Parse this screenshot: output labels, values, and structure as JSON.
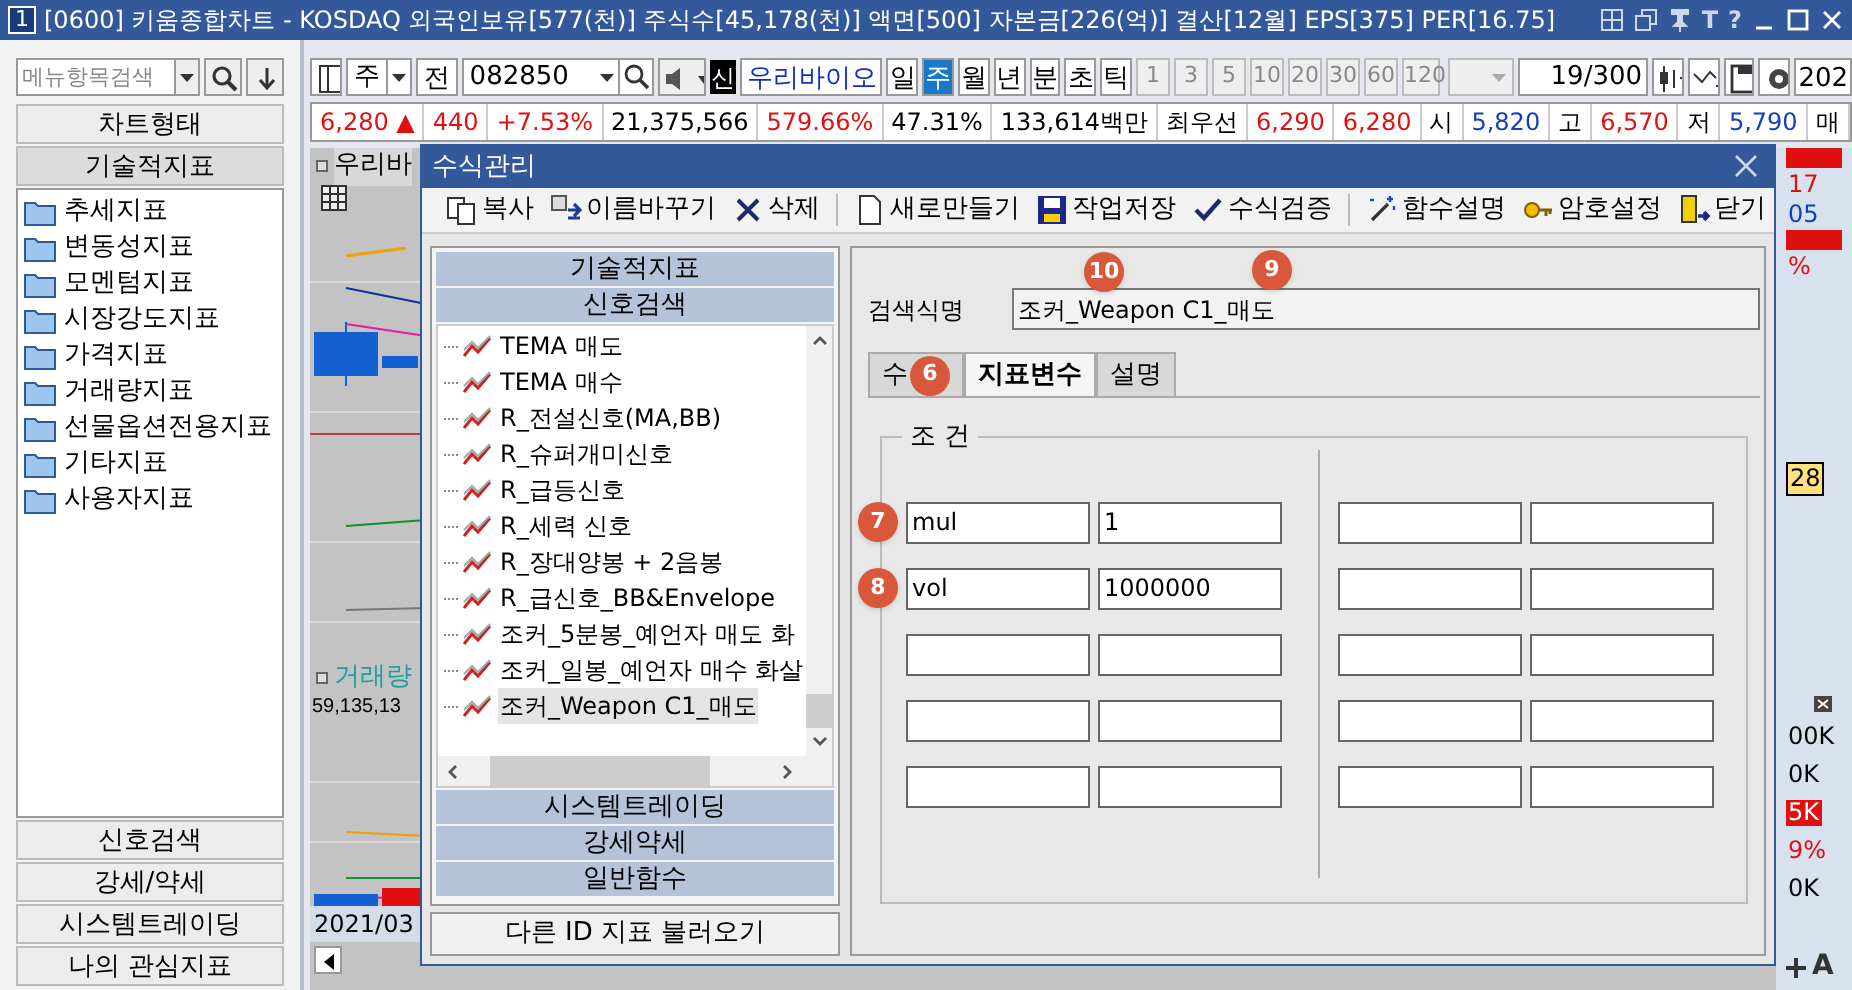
{
  "window": {
    "number": "1",
    "title": "[0600] 키움종합차트 - KOSDAQ 외국인보유[577(천)] 주식수[45,178(천)] 액면[500] 자본금[226(억)] 결산[12월] EPS[375] PER[16.75]",
    "glyphs": [
      "T",
      "?"
    ]
  },
  "sidebar": {
    "search": {
      "placeholder": "메뉴항목검색"
    },
    "top_sections": [
      {
        "label": "차트형태",
        "expanded": false
      },
      {
        "label": "기술적지표",
        "expanded": true
      }
    ],
    "folders": [
      "추세지표",
      "변동성지표",
      "모멘텀지표",
      "시장강도지표",
      "가격지표",
      "거래량지표",
      "선물옵션전용지표",
      "기타지표",
      "사용자지표"
    ],
    "bottom_sections": [
      "신호검색",
      "강세/약세",
      "시스템트레이딩",
      "나의 관심지표"
    ]
  },
  "toolbar": {
    "period": "주",
    "prev": "전",
    "code": "082850",
    "badge": "신",
    "stock_name": "우리바이오",
    "periods": [
      {
        "label": "일",
        "selected": false
      },
      {
        "label": "주",
        "selected": true
      },
      {
        "label": "월",
        "selected": false
      },
      {
        "label": "년",
        "selected": false
      }
    ],
    "intervals": [
      "분",
      "초",
      "틱"
    ],
    "numbers": [
      "1",
      "3",
      "5",
      "10",
      "20",
      "30",
      "60",
      "120"
    ],
    "count": "19",
    "total": "/300",
    "cut": "202"
  },
  "quote": [
    {
      "text": "6,280 ▲",
      "color": "#e01010"
    },
    {
      "text": "440",
      "color": "#e01010"
    },
    {
      "text": "+7.53%",
      "color": "#e01010"
    },
    {
      "text": "21,375,566",
      "color": "#000000"
    },
    {
      "text": "579.66%",
      "color": "#e01010"
    },
    {
      "text": "47.31%",
      "color": "#000000"
    },
    {
      "text": "133,614백만",
      "color": "#000000"
    },
    {
      "text": "최우선",
      "color": "#000000"
    },
    {
      "text": "6,290",
      "color": "#e01010"
    },
    {
      "text": "6,280",
      "color": "#e01010"
    },
    {
      "text": "시",
      "color": "#000000"
    },
    {
      "text": "5,820",
      "color": "#1040c0"
    },
    {
      "text": "고",
      "color": "#000000"
    },
    {
      "text": "6,570",
      "color": "#e01010"
    },
    {
      "text": "저",
      "color": "#000000"
    },
    {
      "text": "5,790",
      "color": "#1040c0"
    },
    {
      "text": "매",
      "color": "#000000"
    }
  ],
  "chart": {
    "title": "우리바",
    "volume_label": "거래량",
    "volume_value": "59,135,13",
    "date": "2021/03",
    "axis_labels": [
      {
        "text": "17",
        "kind": "red"
      },
      {
        "text": "05",
        "kind": "blue"
      },
      {
        "text": "%",
        "kind": "red"
      },
      {
        "text": "28",
        "kind": "box"
      }
    ],
    "volume_axis_labels": [
      {
        "text": "00K",
        "kind": "plain"
      },
      {
        "text": "0K",
        "kind": "plain"
      },
      {
        "text": "5K",
        "kind": "marker"
      },
      {
        "text": "9%",
        "kind": "red"
      },
      {
        "text": "0K",
        "kind": "plain"
      }
    ],
    "corner_label": "A"
  },
  "dialog": {
    "title": "수식관리",
    "toolbar": [
      {
        "label": "복사",
        "kind": "copy"
      },
      {
        "label": "이름바꾸기",
        "kind": "rename"
      },
      {
        "label": "삭제",
        "kind": "delete"
      },
      {
        "label": "새로만들기",
        "kind": "new"
      },
      {
        "label": "작업저장",
        "kind": "save"
      },
      {
        "label": "수식검증",
        "kind": "check"
      },
      {
        "label": "함수설명",
        "kind": "wand"
      },
      {
        "label": "암호설정",
        "kind": "key"
      },
      {
        "label": "닫기",
        "kind": "exit"
      }
    ],
    "categories_top": [
      "기술적지표",
      "신호검색"
    ],
    "items": [
      {
        "label": "TEMA 매도",
        "selected": false
      },
      {
        "label": "TEMA 매수",
        "selected": false
      },
      {
        "label": "R_전설신호(MA,BB)",
        "selected": false
      },
      {
        "label": "R_슈퍼개미신호",
        "selected": false
      },
      {
        "label": "R_급등신호",
        "selected": false
      },
      {
        "label": "R_세력 신호",
        "selected": false
      },
      {
        "label": "R_장대양봉 + 2음봉",
        "selected": false
      },
      {
        "label": "R_급신호_BB&Envelope",
        "selected": false
      },
      {
        "label": "조커_5분봉_예언자 매도 화",
        "selected": false
      },
      {
        "label": "조커_일봉_예언자 매수 화살",
        "selected": false
      },
      {
        "label": "조커_Weapon C1_매도",
        "selected": true
      }
    ],
    "categories_bottom": [
      "시스템트레이딩",
      "강세약세",
      "일반함수"
    ],
    "load_button": "다른 ID 지표 불러오기",
    "name_label": "검색식명",
    "name_value": "조커_Weapon C1_매도",
    "name_callouts": [
      "10",
      "9"
    ],
    "tabs": [
      {
        "label": "수",
        "selected": false,
        "callout": "6"
      },
      {
        "label": "지표변수",
        "selected": true
      },
      {
        "label": "설명",
        "selected": false
      }
    ],
    "group_label": "조 건",
    "variables": [
      {
        "name": "mul",
        "value": "1",
        "callout": "7"
      },
      {
        "name": "vol",
        "value": "1000000",
        "callout": "8"
      }
    ]
  }
}
